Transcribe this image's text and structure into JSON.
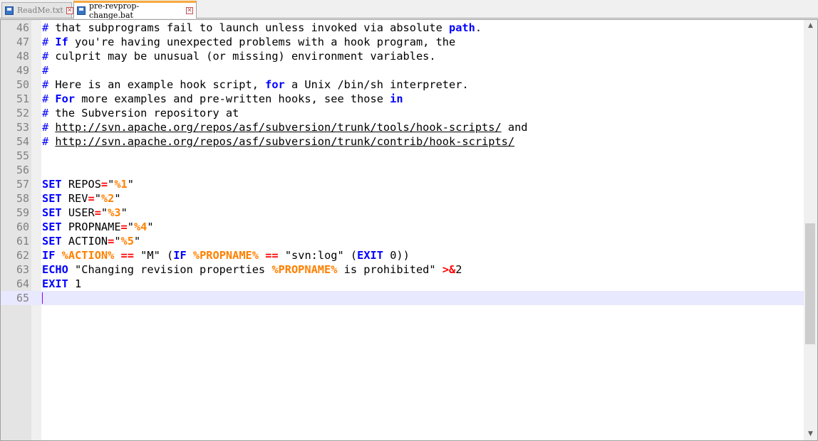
{
  "tabs": [
    {
      "label": "ReadMe.txt",
      "active": false,
      "icon": "save-icon",
      "close_icon": "close-icon"
    },
    {
      "label": "pre-revprop-change.bat",
      "active": true,
      "icon": "save-icon",
      "close_icon": "close-icon"
    }
  ],
  "editor": {
    "current_line": "65",
    "lines": [
      {
        "n": "46",
        "segments": [
          {
            "t": "# ",
            "c": "hash"
          },
          {
            "t": "that subprograms fail to launch unless invoked via absolute ",
            "c": "cm"
          },
          {
            "t": "path",
            "c": "kw"
          },
          {
            "t": ".",
            "c": "cm"
          }
        ]
      },
      {
        "n": "47",
        "segments": [
          {
            "t": "# ",
            "c": "hash"
          },
          {
            "t": "If",
            "c": "kw"
          },
          {
            "t": " you're having unexpected problems with a hook program, the",
            "c": "cm"
          }
        ]
      },
      {
        "n": "48",
        "segments": [
          {
            "t": "# ",
            "c": "hash"
          },
          {
            "t": "culprit may be unusual (or missing) environment variables.",
            "c": "cm"
          }
        ]
      },
      {
        "n": "49",
        "segments": [
          {
            "t": "#",
            "c": "hash"
          }
        ]
      },
      {
        "n": "50",
        "segments": [
          {
            "t": "# ",
            "c": "hash"
          },
          {
            "t": "Here is an example hook script, ",
            "c": "cm"
          },
          {
            "t": "for",
            "c": "kw"
          },
          {
            "t": " a Unix /bin/sh interpreter.",
            "c": "cm"
          }
        ]
      },
      {
        "n": "51",
        "segments": [
          {
            "t": "# ",
            "c": "hash"
          },
          {
            "t": "For",
            "c": "kw"
          },
          {
            "t": " more examples and pre-written hooks, see those ",
            "c": "cm"
          },
          {
            "t": "in",
            "c": "kw"
          }
        ]
      },
      {
        "n": "52",
        "segments": [
          {
            "t": "# ",
            "c": "hash"
          },
          {
            "t": "the Subversion repository at",
            "c": "cm"
          }
        ]
      },
      {
        "n": "53",
        "segments": [
          {
            "t": "# ",
            "c": "hash"
          },
          {
            "t": "http://svn.apache.org/repos/asf/subversion/trunk/tools/hook-scripts/",
            "c": "url"
          },
          {
            "t": " and",
            "c": "cm"
          }
        ]
      },
      {
        "n": "54",
        "segments": [
          {
            "t": "# ",
            "c": "hash"
          },
          {
            "t": "http://svn.apache.org/repos/asf/subversion/trunk/contrib/hook-scripts/",
            "c": "url"
          }
        ]
      },
      {
        "n": "55",
        "segments": []
      },
      {
        "n": "56",
        "segments": []
      },
      {
        "n": "57",
        "segments": [
          {
            "t": "SET",
            "c": "kw"
          },
          {
            "t": " REPOS",
            "c": "cm"
          },
          {
            "t": "=",
            "c": "op"
          },
          {
            "t": "\"",
            "c": "cm"
          },
          {
            "t": "%1",
            "c": "varb"
          },
          {
            "t": "\"",
            "c": "cm"
          }
        ]
      },
      {
        "n": "58",
        "segments": [
          {
            "t": "SET",
            "c": "kw"
          },
          {
            "t": " REV",
            "c": "cm"
          },
          {
            "t": "=",
            "c": "op"
          },
          {
            "t": "\"",
            "c": "cm"
          },
          {
            "t": "%2",
            "c": "varb"
          },
          {
            "t": "\"",
            "c": "cm"
          }
        ]
      },
      {
        "n": "59",
        "segments": [
          {
            "t": "SET",
            "c": "kw"
          },
          {
            "t": " USER",
            "c": "cm"
          },
          {
            "t": "=",
            "c": "op"
          },
          {
            "t": "\"",
            "c": "cm"
          },
          {
            "t": "%3",
            "c": "varb"
          },
          {
            "t": "\"",
            "c": "cm"
          }
        ]
      },
      {
        "n": "60",
        "segments": [
          {
            "t": "SET",
            "c": "kw"
          },
          {
            "t": " PROPNAME",
            "c": "cm"
          },
          {
            "t": "=",
            "c": "op"
          },
          {
            "t": "\"",
            "c": "cm"
          },
          {
            "t": "%4",
            "c": "varb"
          },
          {
            "t": "\"",
            "c": "cm"
          }
        ]
      },
      {
        "n": "61",
        "segments": [
          {
            "t": "SET",
            "c": "kw"
          },
          {
            "t": " ACTION",
            "c": "cm"
          },
          {
            "t": "=",
            "c": "op"
          },
          {
            "t": "\"",
            "c": "cm"
          },
          {
            "t": "%5",
            "c": "varb"
          },
          {
            "t": "\"",
            "c": "cm"
          }
        ]
      },
      {
        "n": "62",
        "segments": [
          {
            "t": "IF",
            "c": "kw"
          },
          {
            "t": " ",
            "c": "cm"
          },
          {
            "t": "%ACTION%",
            "c": "varb"
          },
          {
            "t": " ",
            "c": "cm"
          },
          {
            "t": "==",
            "c": "op"
          },
          {
            "t": " \"M\" (",
            "c": "cm"
          },
          {
            "t": "IF",
            "c": "kw"
          },
          {
            "t": " ",
            "c": "cm"
          },
          {
            "t": "%PROPNAME%",
            "c": "varb"
          },
          {
            "t": " ",
            "c": "cm"
          },
          {
            "t": "==",
            "c": "op"
          },
          {
            "t": " \"svn:log\" (",
            "c": "cm"
          },
          {
            "t": "EXIT",
            "c": "kw"
          },
          {
            "t": " 0))",
            "c": "cm"
          }
        ]
      },
      {
        "n": "63",
        "segments": [
          {
            "t": "ECHO",
            "c": "kw"
          },
          {
            "t": " \"Changing revision properties ",
            "c": "cm"
          },
          {
            "t": "%PROPNAME%",
            "c": "varb"
          },
          {
            "t": " is prohibited\" ",
            "c": "cm"
          },
          {
            "t": ">&",
            "c": "op"
          },
          {
            "t": "2",
            "c": "cm"
          }
        ]
      },
      {
        "n": "64",
        "segments": [
          {
            "t": "EXIT",
            "c": "kw"
          },
          {
            "t": " 1",
            "c": "cm"
          }
        ]
      },
      {
        "n": "65",
        "segments": []
      }
    ]
  },
  "scrollbar": {
    "up_icon": "up-arrow-icon",
    "down_icon": "down-arrow-icon"
  }
}
